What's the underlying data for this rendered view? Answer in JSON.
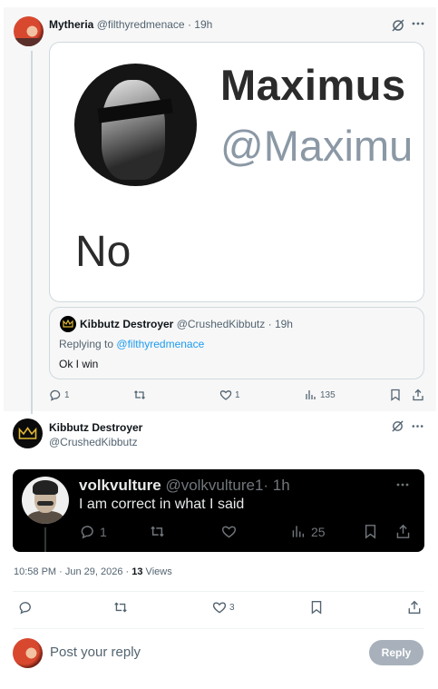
{
  "tweet1": {
    "author_name": "Mytheria",
    "author_handle": "@filthyredmenace",
    "time": "· 19h",
    "image": {
      "name": "Maximus",
      "handle": "@Maximu",
      "text": "No"
    },
    "quote": {
      "author_name": "Kibbutz Destroyer",
      "author_handle": "@CrushedKibbutz",
      "time": "· 19h",
      "replying_prefix": "Replying to",
      "replying_to": "@filthyredmenace",
      "text": "Ok I win"
    },
    "actions": {
      "replies": "1",
      "likes": "1",
      "views": "135"
    }
  },
  "tweet2": {
    "author_name": "Kibbutz Destroyer",
    "author_handle": "@CrushedKibbutz",
    "embedded": {
      "author_name": "volkvulture",
      "author_handle": "@volkvulture1",
      "time": "· 1h",
      "text": "I am correct in what I said",
      "replies": "1",
      "views": "25"
    },
    "meta": {
      "timestamp": "10:58 PM · Jun 29, 2026 · ",
      "views_count": "13",
      "views_label": " Views"
    },
    "actions": {
      "likes": "3"
    }
  },
  "reply": {
    "placeholder": "Post your reply",
    "button_label": "Reply"
  },
  "colors": {
    "text_primary": "#0f1419",
    "text_secondary": "#536471",
    "link": "#1d9bf0",
    "dark_card_bg": "#000000",
    "reply_button_disabled": "#8b98a5"
  }
}
